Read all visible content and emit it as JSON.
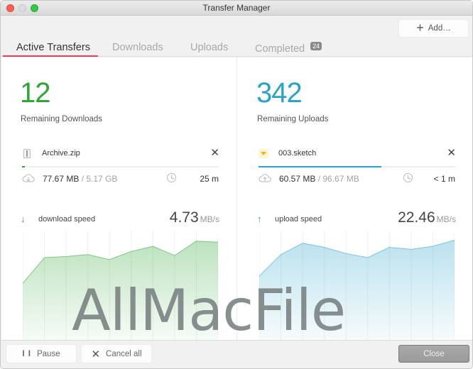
{
  "window": {
    "title": "Transfer Manager"
  },
  "toolbar": {
    "add_label": "Add…",
    "add_icon": "plus-icon"
  },
  "tabs": [
    {
      "label": "Active Transfers",
      "active": true
    },
    {
      "label": "Downloads",
      "active": false
    },
    {
      "label": "Uploads",
      "active": false
    },
    {
      "label": "Completed",
      "active": false,
      "badge": "24"
    }
  ],
  "downloads": {
    "count": "12",
    "count_label": "Remaining Downloads",
    "file": {
      "name": "Archive.zip",
      "icon": "zip-file-icon",
      "progress": 0.015
    },
    "transferred": "77.67 MB",
    "total": " / 5.17 GB",
    "eta": "25 m",
    "speed_label": "download speed",
    "speed_value": "4.73",
    "speed_unit": "MB/s",
    "color": "#2fa636"
  },
  "uploads": {
    "count": "342",
    "count_label": "Remaining Uploads",
    "file": {
      "name": "003.sketch",
      "icon": "sketch-file-icon",
      "progress": 0.625
    },
    "transferred": "60.57 MB",
    "total": " / 96.67 MB",
    "eta": "< 1 m",
    "speed_label": "upload speed",
    "speed_value": "22.46",
    "speed_unit": "MB/s",
    "color": "#2aa3c9"
  },
  "chart_data": [
    {
      "type": "area",
      "title": "download speed",
      "x": [
        0,
        1,
        2,
        3,
        4,
        5,
        6,
        7,
        8,
        9
      ],
      "values": [
        0.55,
        0.8,
        0.81,
        0.83,
        0.78,
        0.86,
        0.91,
        0.82,
        0.96,
        0.95
      ],
      "ylim": [
        0,
        1
      ],
      "grid": true,
      "color": "#2fa636"
    },
    {
      "type": "area",
      "title": "upload speed",
      "x": [
        0,
        1,
        2,
        3,
        4,
        5,
        6,
        7,
        8,
        9
      ],
      "values": [
        0.62,
        0.83,
        0.94,
        0.9,
        0.84,
        0.8,
        0.9,
        0.88,
        0.91,
        0.97
      ],
      "ylim": [
        0,
        1
      ],
      "grid": true,
      "color": "#2aa3c9"
    }
  ],
  "footer": {
    "pause_label": "Pause",
    "cancel_label": "Cancel all",
    "close_label": "Close"
  },
  "watermark": "AllMacFile"
}
